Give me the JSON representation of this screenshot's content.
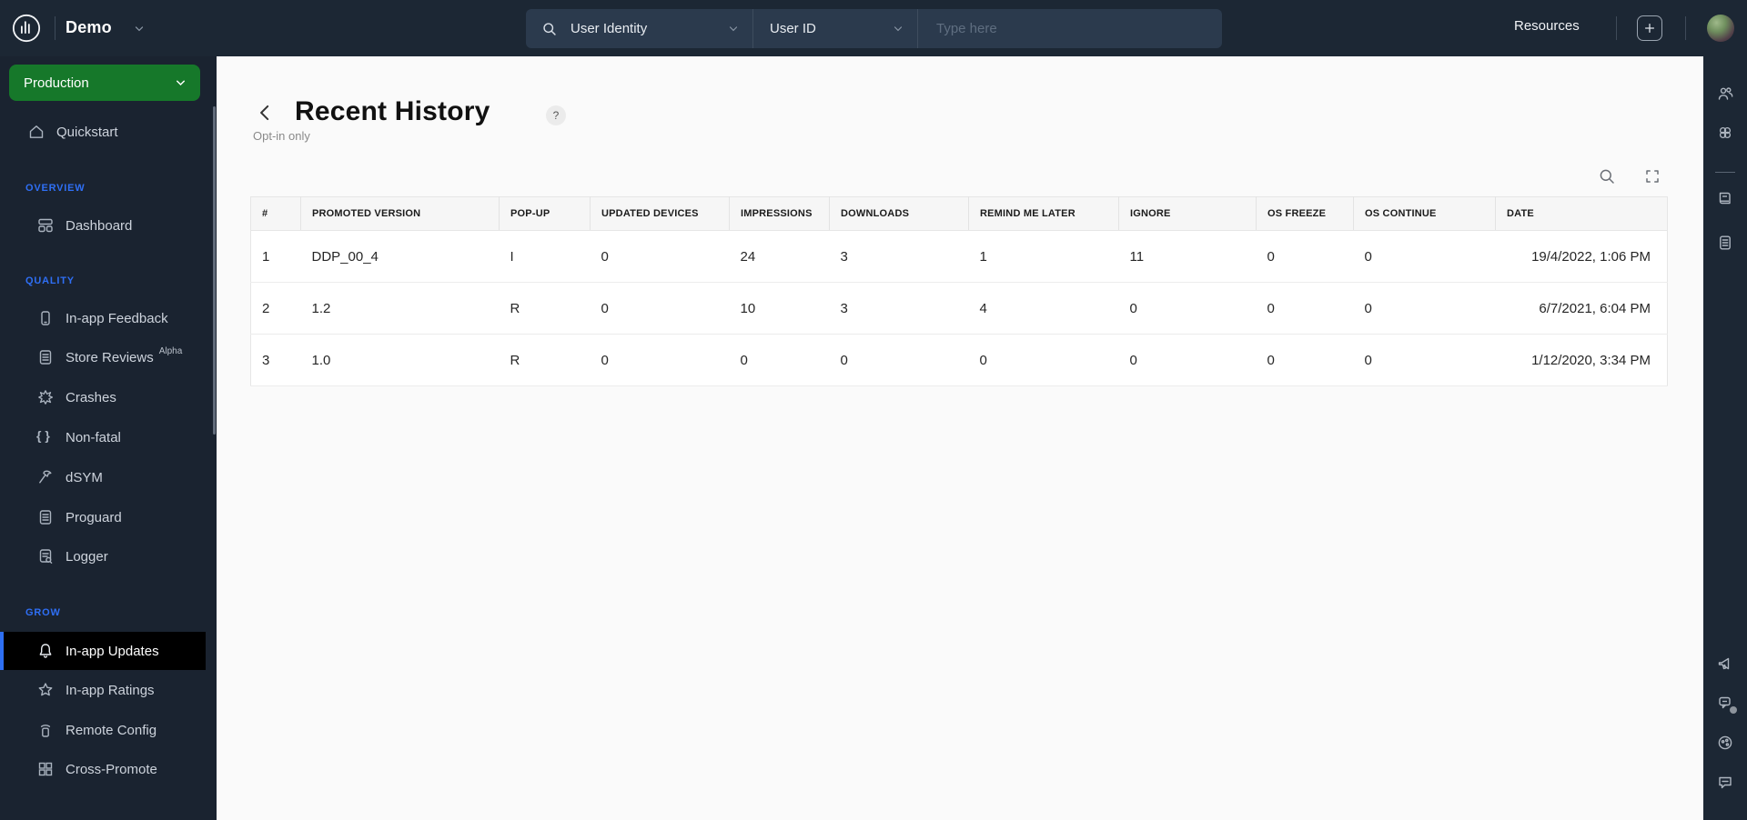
{
  "topbar": {
    "app_name": "Demo",
    "search": {
      "category": "User Identity",
      "field": "User ID",
      "placeholder": "Type here"
    },
    "resources_label": "Resources"
  },
  "sidebar": {
    "environment": "Production",
    "quickstart_label": "Quickstart",
    "sections": {
      "overview": {
        "label": "OVERVIEW",
        "items": [
          "Dashboard"
        ]
      },
      "quality": {
        "label": "QUALITY",
        "items": [
          "In-app Feedback",
          "Store Reviews",
          "Crashes",
          "Non-fatal",
          "dSYM",
          "Proguard",
          "Logger"
        ],
        "store_reviews_badge": "Alpha"
      },
      "grow": {
        "label": "GROW",
        "items": [
          "In-app Updates",
          "In-app Ratings",
          "Remote Config",
          "Cross-Promote"
        ]
      }
    }
  },
  "main": {
    "title": "Recent History",
    "subtitle": "Opt-in only",
    "help_glyph": "?",
    "table": {
      "columns": [
        "#",
        "PROMOTED VERSION",
        "POP-UP",
        "UPDATED DEVICES",
        "IMPRESSIONS",
        "DOWNLOADS",
        "REMIND ME LATER",
        "IGNORE",
        "OS FREEZE",
        "OS CONTINUE",
        "DATE"
      ],
      "rows": [
        [
          "1",
          "DDP_00_4",
          "I",
          "0",
          "24",
          "3",
          "1",
          "11",
          "0",
          "0",
          "19/4/2022, 1:06 PM"
        ],
        [
          "2",
          "1.2",
          "R",
          "0",
          "10",
          "3",
          "4",
          "0",
          "0",
          "0",
          "6/7/2021, 6:04 PM"
        ],
        [
          "3",
          "1.0",
          "R",
          "0",
          "0",
          "0",
          "0",
          "0",
          "0",
          "0",
          "1/12/2020, 3:34 PM"
        ]
      ]
    }
  },
  "icons": {
    "braces_glyph": "{ }"
  },
  "colors": {
    "accent_blue": "#2e6ff2",
    "env_green": "#16782a",
    "topbar_bg": "#1c2734",
    "active_item_bg": "#000000"
  }
}
